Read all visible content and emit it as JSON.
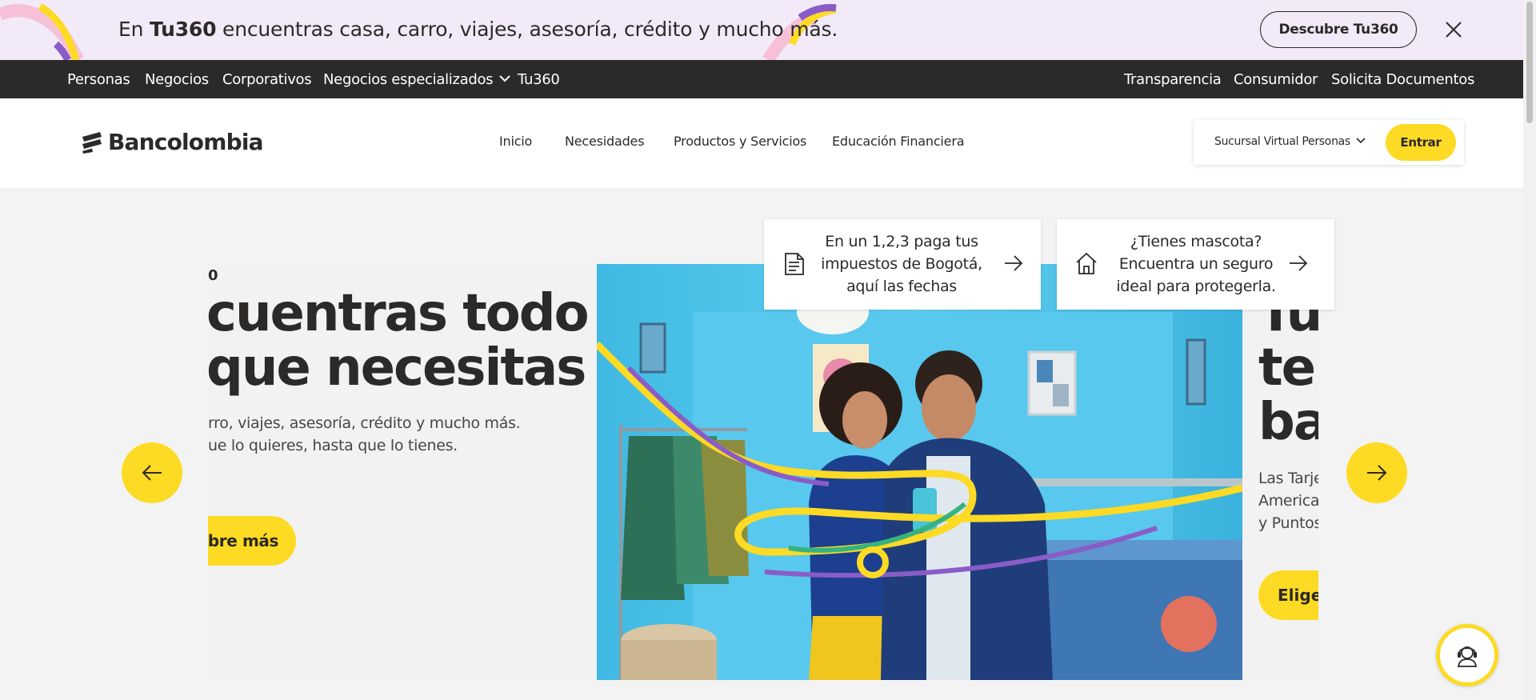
{
  "promo": {
    "text_prefix": "En ",
    "brand": "Tu360",
    "text_suffix": " encuentras casa, carro, viajes, asesoría, crédito y mucho más.",
    "button_label": "Descubre Tu360"
  },
  "segment_nav": {
    "left_items": [
      "Personas",
      "Negocios",
      "Corporativos",
      "Negocios especializados",
      "Tu360"
    ],
    "right_items": [
      "Transparencia",
      "Consumidor",
      "Solicita Documentos"
    ]
  },
  "header": {
    "logo_text": "Bancolombia",
    "nav": [
      "Inicio",
      "Necesidades",
      "Productos y Servicios",
      "Educación Financiera"
    ],
    "sucursal_label": "Sucursal Virtual Personas",
    "entrar_label": "Entrar"
  },
  "hero": {
    "eyebrow": "0",
    "title": "cuentras todo\nque necesitas",
    "description": "rro, viajes, asesoría, crédito y mucho más.\nue lo quieres, hasta que lo tienes.",
    "cta": "ubre más",
    "next_title": "Tu\nte\nba",
    "next_description": "Las Tarje\nAmerican\ny Puntos",
    "next_cta": "Elige"
  },
  "quick_cards": [
    {
      "text": "En un 1,2,3 paga tus\nimpuestos de Bogotá,\naquí las fechas",
      "icon": "document-icon"
    },
    {
      "text": "¿Tienes mascota?\nEncuentra un seguro\nideal para protegerla.",
      "icon": "home-icon"
    }
  ],
  "colors": {
    "brand_yellow": "#fdda24",
    "dark": "#2c2a29",
    "promo_bg": "#f2eaf8",
    "page_bg": "#f3f3f3",
    "hero_blue": "#4dc8ea"
  }
}
